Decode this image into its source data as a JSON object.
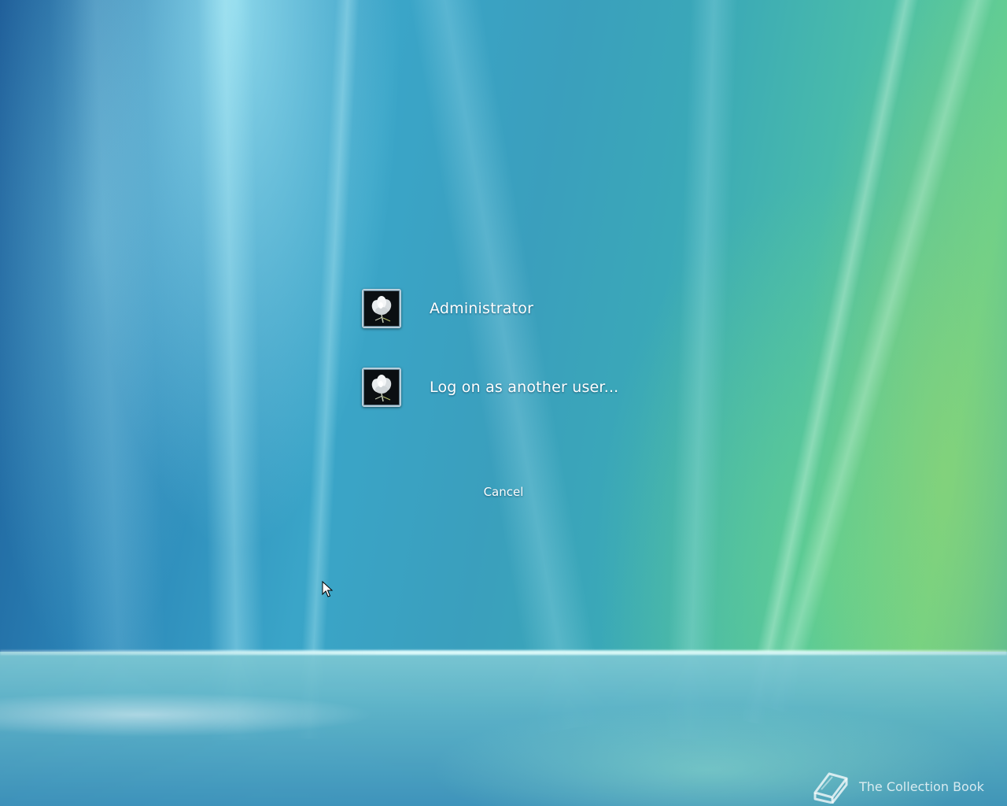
{
  "users": [
    {
      "label": "Administrator",
      "avatar_icon": "white-flower-icon"
    },
    {
      "label": "Log on as another user...",
      "avatar_icon": "white-flower-icon"
    }
  ],
  "cancel_label": "Cancel",
  "branding": {
    "label": "The Collection Book",
    "icon": "book-icon"
  },
  "colors": {
    "text": "#ffffff",
    "avatar_bg": "#0b0f12",
    "avatar_border": "#b8cfdc"
  }
}
